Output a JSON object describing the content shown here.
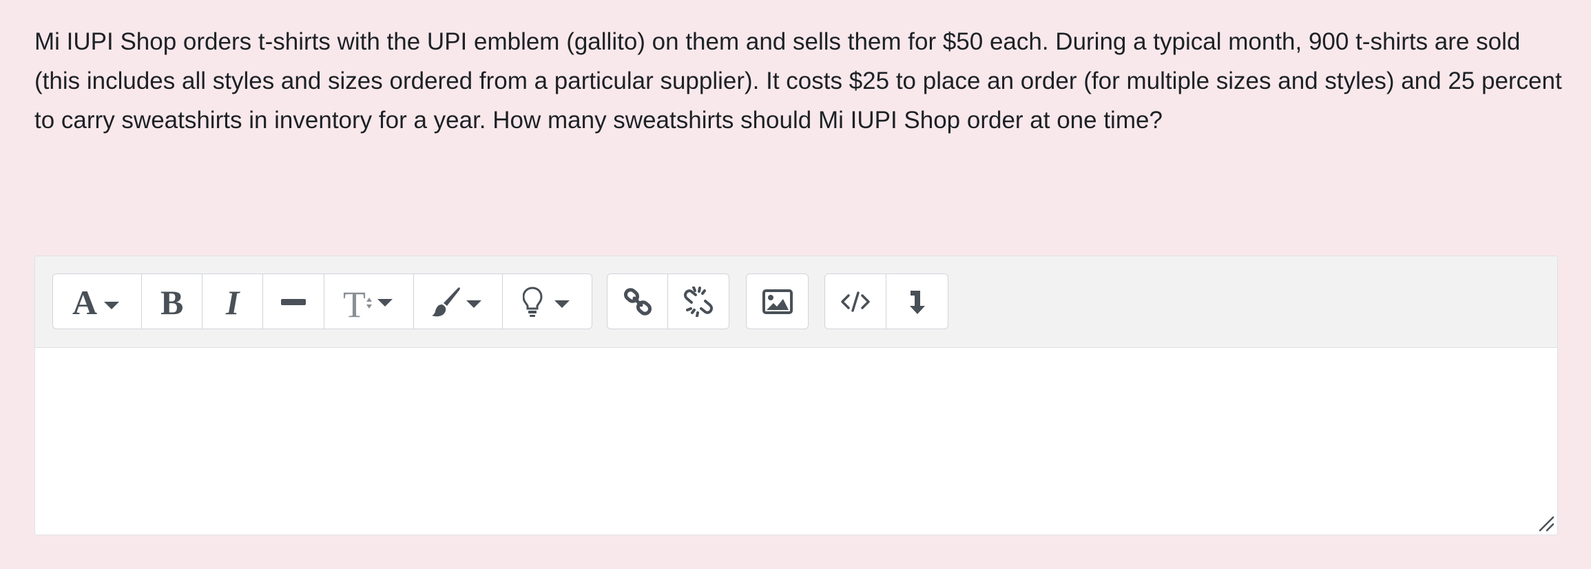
{
  "question": {
    "text": "Mi IUPI Shop orders t-shirts with the UPI emblem (gallito) on them and sells them for $50 each. During a typical month, 900 t-shirts are sold (this includes all styles and sizes ordered from a particular supplier). It costs $25 to place an order (for multiple sizes and styles) and 25 percent to carry sweatshirts in inventory for a year. How many sweatshirts should Mi IUPI Shop order at one time?"
  },
  "editor": {
    "content": "",
    "toolbar": {
      "groups": [
        [
          "font-style-icon",
          "bold-icon",
          "italic-icon",
          "horizontal-rule-icon",
          "font-size-icon",
          "paint-brush-icon",
          "lightbulb-icon"
        ],
        [
          "link-icon",
          "unlink-icon"
        ],
        [
          "image-icon"
        ],
        [
          "code-icon",
          "insert-below-icon"
        ]
      ]
    }
  },
  "colors": {
    "page_background": "#f8e8eb",
    "toolbar_background": "#f2f2f2",
    "icon": "#495057"
  }
}
